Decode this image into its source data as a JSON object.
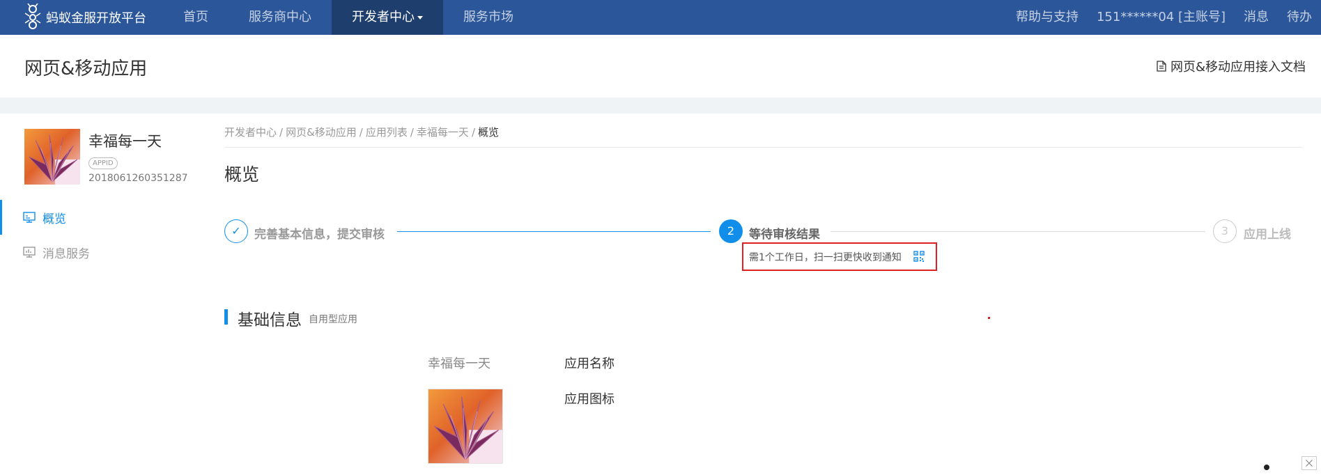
{
  "topnav": {
    "brand": "蚂蚁金服开放平台",
    "items": [
      {
        "label": "首页"
      },
      {
        "label": "服务商中心"
      },
      {
        "label": "开发者中心"
      },
      {
        "label": "服务市场"
      }
    ],
    "right": {
      "help": "帮助与支持",
      "account": "151******04 [主账号]",
      "messages": "消息",
      "todo": "待办"
    }
  },
  "pagehead": {
    "title": "网页&移动应用",
    "doc_link": "网页&移动应用接入文档"
  },
  "sidebar": {
    "app_name": "幸福每一天",
    "appid_badge": "APPID",
    "appid": "2018061260351287",
    "menu": [
      {
        "label": "概览",
        "icon": "monitor-icon",
        "active": true
      },
      {
        "label": "消息服务",
        "icon": "chart-icon",
        "active": false
      }
    ]
  },
  "breadcrumb": {
    "items": [
      "开发者中心",
      "网页&移动应用",
      "应用列表",
      "幸福每一天"
    ],
    "current": "概览",
    "sep": "/"
  },
  "main": {
    "title": "概览",
    "steps": [
      {
        "num": "✓",
        "label": "完善基本信息，提交审核",
        "status": "done"
      },
      {
        "num": "2",
        "label": "等待审核结果",
        "status": "current"
      },
      {
        "num": "3",
        "label": "应用上线",
        "status": "pending"
      }
    ],
    "step_hint": "需1个工作日，扫一扫更快收到通知",
    "section": {
      "title": "基础信息",
      "subtitle": "自用型应用",
      "name_label": "应用名称",
      "name_value": "幸福每一天",
      "icon_label": "应用图标"
    }
  },
  "colors": {
    "nav_bg": "#2b579a",
    "nav_active": "#1e3f6e",
    "accent": "#108ee9",
    "highlight_box": "#e02020"
  }
}
